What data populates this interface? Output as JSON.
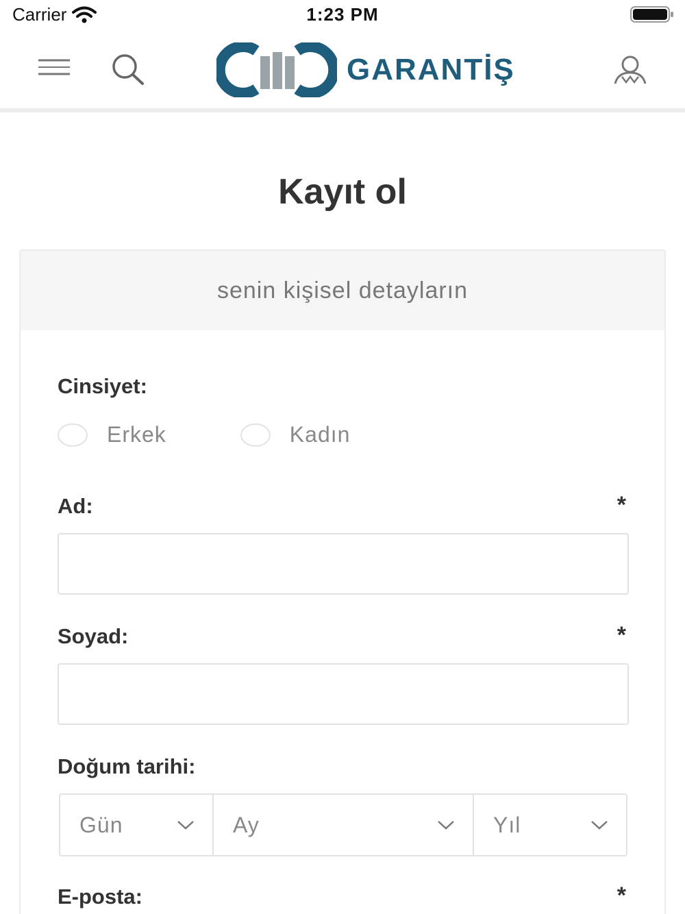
{
  "status_bar": {
    "carrier": "Carrier",
    "time": "1:23 PM"
  },
  "header": {
    "brand": "GARANTİŞ"
  },
  "page": {
    "title": "Kayıt ol"
  },
  "form": {
    "section_title": "senin kişisel detayların",
    "gender": {
      "label": "Cinsiyet:",
      "options": [
        "Erkek",
        "Kadın"
      ]
    },
    "first_name": {
      "label": "Ad:",
      "required": "*",
      "value": ""
    },
    "last_name": {
      "label": "Soyad:",
      "required": "*",
      "value": ""
    },
    "birth_date": {
      "label": "Doğum tarihi:",
      "day": "Gün",
      "month": "Ay",
      "year": "Yıl"
    },
    "email": {
      "label": "E-posta:",
      "required": "*"
    }
  },
  "colors": {
    "brand_blue": "#1e5d7b",
    "brand_gray": "#9aa3a8",
    "border": "#e2e2e2",
    "section_bg": "#f5f5f5"
  }
}
